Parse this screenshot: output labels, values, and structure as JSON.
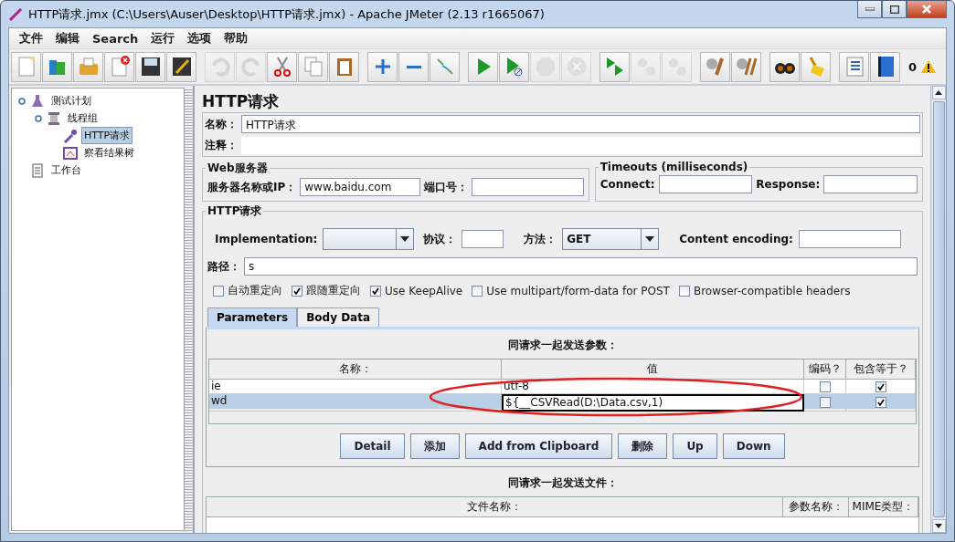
{
  "window": {
    "title": "HTTP请求.jmx (C:\\Users\\Auser\\Desktop\\HTTP请求.jmx) - Apache JMeter (2.13 r1665067)"
  },
  "menu": [
    "文件",
    "编辑",
    "Search",
    "运行",
    "选项",
    "帮助"
  ],
  "toolbar": {
    "groups": [
      [
        {
          "kind": "new",
          "disabled": false
        },
        {
          "kind": "templates",
          "disabled": false
        },
        {
          "kind": "open",
          "disabled": false
        },
        {
          "kind": "close",
          "disabled": false
        },
        {
          "kind": "save",
          "disabled": false
        },
        {
          "kind": "save-as",
          "disabled": false
        }
      ],
      [
        {
          "kind": "undo",
          "disabled": true
        },
        {
          "kind": "redo",
          "disabled": true
        },
        {
          "kind": "cut",
          "disabled": false
        },
        {
          "kind": "copy",
          "disabled": false
        },
        {
          "kind": "paste",
          "disabled": false
        }
      ],
      [
        {
          "kind": "expand",
          "disabled": false
        },
        {
          "kind": "collapse",
          "disabled": false
        },
        {
          "kind": "toggle",
          "disabled": false
        }
      ],
      [
        {
          "kind": "start",
          "disabled": false
        },
        {
          "kind": "start-no-pause",
          "disabled": false
        },
        {
          "kind": "stop",
          "disabled": true
        },
        {
          "kind": "shutdown",
          "disabled": true
        }
      ],
      [
        {
          "kind": "remote-start",
          "disabled": false
        },
        {
          "kind": "remote-stop",
          "disabled": true
        },
        {
          "kind": "remote-shutdown",
          "disabled": true
        }
      ],
      [
        {
          "kind": "clear",
          "disabled": false
        },
        {
          "kind": "clear-all",
          "disabled": false
        }
      ],
      [
        {
          "kind": "search",
          "disabled": false
        },
        {
          "kind": "reset-search",
          "disabled": false
        }
      ],
      [
        {
          "kind": "functions",
          "disabled": false
        },
        {
          "kind": "help",
          "disabled": false
        }
      ]
    ],
    "warning_count": "0"
  },
  "tree": [
    {
      "label": "测试计划",
      "kind": "plan",
      "selected": false,
      "children": [
        {
          "label": "线程组",
          "kind": "threads",
          "selected": false,
          "children": [
            {
              "label": "HTTP请求",
              "kind": "sampler",
              "selected": true
            },
            {
              "label": "察看结果树",
              "kind": "listener",
              "selected": false
            }
          ]
        }
      ]
    },
    {
      "label": "工作台",
      "kind": "workbench",
      "selected": false
    }
  ],
  "panel": {
    "title": "HTTP请求",
    "name": {
      "label": "名称：",
      "value": "HTTP请求"
    },
    "comment": {
      "label": "注释："
    },
    "web_server": {
      "legend": "Web服务器",
      "server_label": "服务器名称或IP：",
      "server_value": "www.baidu.com",
      "port_label": "端口号："
    },
    "timeouts": {
      "legend": "Timeouts (milliseconds)",
      "connect_label": "Connect:",
      "response_label": "Response:"
    },
    "http_request": {
      "legend": "HTTP请求",
      "implementation_label": "Implementation:",
      "protocol_label": "协议：",
      "method_label": "方法：",
      "method_value": "GET",
      "encoding_label": "Content encoding:",
      "path_label": "路径：",
      "path_value": "s",
      "options": [
        {
          "label": "自动重定向",
          "checked": false
        },
        {
          "label": "跟随重定向",
          "checked": true
        },
        {
          "label": "Use KeepAlive",
          "checked": true
        },
        {
          "label": "Use multipart/form-data for POST",
          "checked": false
        },
        {
          "label": "Browser-compatible headers",
          "checked": false
        }
      ]
    },
    "tabs": [
      {
        "label": "Parameters",
        "selected": true
      },
      {
        "label": "Body Data",
        "selected": false
      }
    ],
    "parameters": {
      "caption": "同请求一起发送参数：",
      "columns": [
        "名称：",
        "值",
        "编码？",
        "包含等于？"
      ],
      "rows": [
        {
          "name": "ie",
          "value": "utf-8",
          "encode": false,
          "include_equals": true,
          "selected": false,
          "editing": false
        },
        {
          "name": "wd",
          "value": "${__CSVRead(D:\\Data.csv,1)",
          "encode": false,
          "include_equals": true,
          "selected": true,
          "editing": true
        }
      ],
      "buttons": [
        "Detail",
        "添加",
        "Add from Clipboard",
        "删除",
        "Up",
        "Down"
      ]
    },
    "files": {
      "caption": "同请求一起发送文件：",
      "columns": [
        "文件名称：",
        "参数名称：",
        "MIME类型："
      ]
    }
  }
}
